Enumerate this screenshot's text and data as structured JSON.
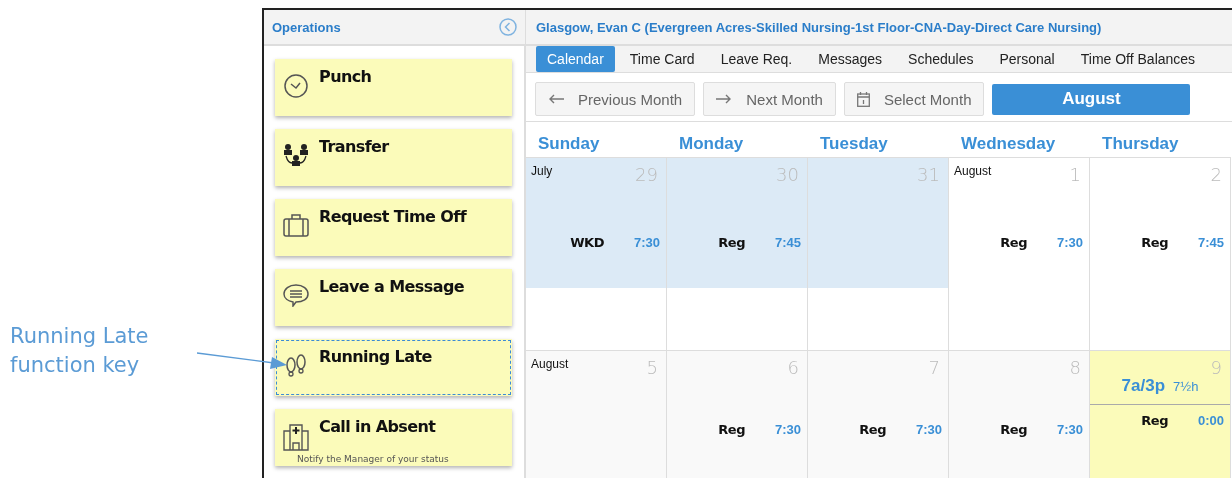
{
  "annotation": {
    "text": "Running Late function key"
  },
  "sidebar": {
    "title": "Operations",
    "function_keys": [
      {
        "label": "Punch",
        "focused": false
      },
      {
        "label": "Transfer",
        "focused": false
      },
      {
        "label": "Request Time Off",
        "focused": false
      },
      {
        "label": "Leave a Message",
        "focused": false
      },
      {
        "label": "Running Late",
        "focused": true
      },
      {
        "label": "Call in Absent",
        "subtitle": "Notify the Manager of your status",
        "focused": false
      }
    ]
  },
  "header": {
    "title": "Glasgow, Evan C (Evergreen Acres-Skilled Nursing-1st Floor-CNA-Day-Direct Care Nursing)"
  },
  "tabs": [
    {
      "label": "Calendar",
      "selected": true
    },
    {
      "label": "Time Card",
      "selected": false
    },
    {
      "label": "Leave Req.",
      "selected": false
    },
    {
      "label": "Messages",
      "selected": false
    },
    {
      "label": "Schedules",
      "selected": false
    },
    {
      "label": "Personal",
      "selected": false
    },
    {
      "label": "Time Off Balances",
      "selected": false
    }
  ],
  "nav": {
    "previous": "Previous Month",
    "next": "Next Month",
    "select": "Select Month",
    "current": "August"
  },
  "calendar": {
    "days": [
      "Sunday",
      "Monday",
      "Tuesday",
      "Wednesday",
      "Thursday"
    ],
    "weeks": [
      {
        "shaded": false,
        "cells": [
          {
            "month": "July",
            "day": "29",
            "past": true,
            "highlighted": false,
            "entry": {
              "code": "WKD",
              "hours": "7:30"
            }
          },
          {
            "day": "30",
            "past": true,
            "highlighted": false,
            "entry": {
              "code": "Reg",
              "hours": "7:45"
            }
          },
          {
            "day": "31",
            "past": true,
            "highlighted": false
          },
          {
            "month": "August",
            "day": "1",
            "past": false,
            "highlighted": false,
            "entry": {
              "code": "Reg",
              "hours": "7:30"
            }
          },
          {
            "day": "2",
            "past": false,
            "highlighted": false,
            "entry": {
              "code": "Reg",
              "hours": "7:45"
            }
          }
        ]
      },
      {
        "shaded": true,
        "cells": [
          {
            "month": "August",
            "day": "5",
            "past": false,
            "highlighted": false
          },
          {
            "day": "6",
            "past": false,
            "highlighted": false,
            "entry": {
              "code": "Reg",
              "hours": "7:30"
            }
          },
          {
            "day": "7",
            "past": false,
            "highlighted": false,
            "entry": {
              "code": "Reg",
              "hours": "7:30"
            }
          },
          {
            "day": "8",
            "past": false,
            "highlighted": false,
            "entry": {
              "code": "Reg",
              "hours": "7:30"
            }
          },
          {
            "day": "9",
            "past": false,
            "highlighted": true,
            "shift": {
              "time": "7a/3p",
              "length": "7½h"
            },
            "entry": {
              "code": "Reg",
              "hours": "0:00"
            }
          }
        ]
      }
    ]
  }
}
